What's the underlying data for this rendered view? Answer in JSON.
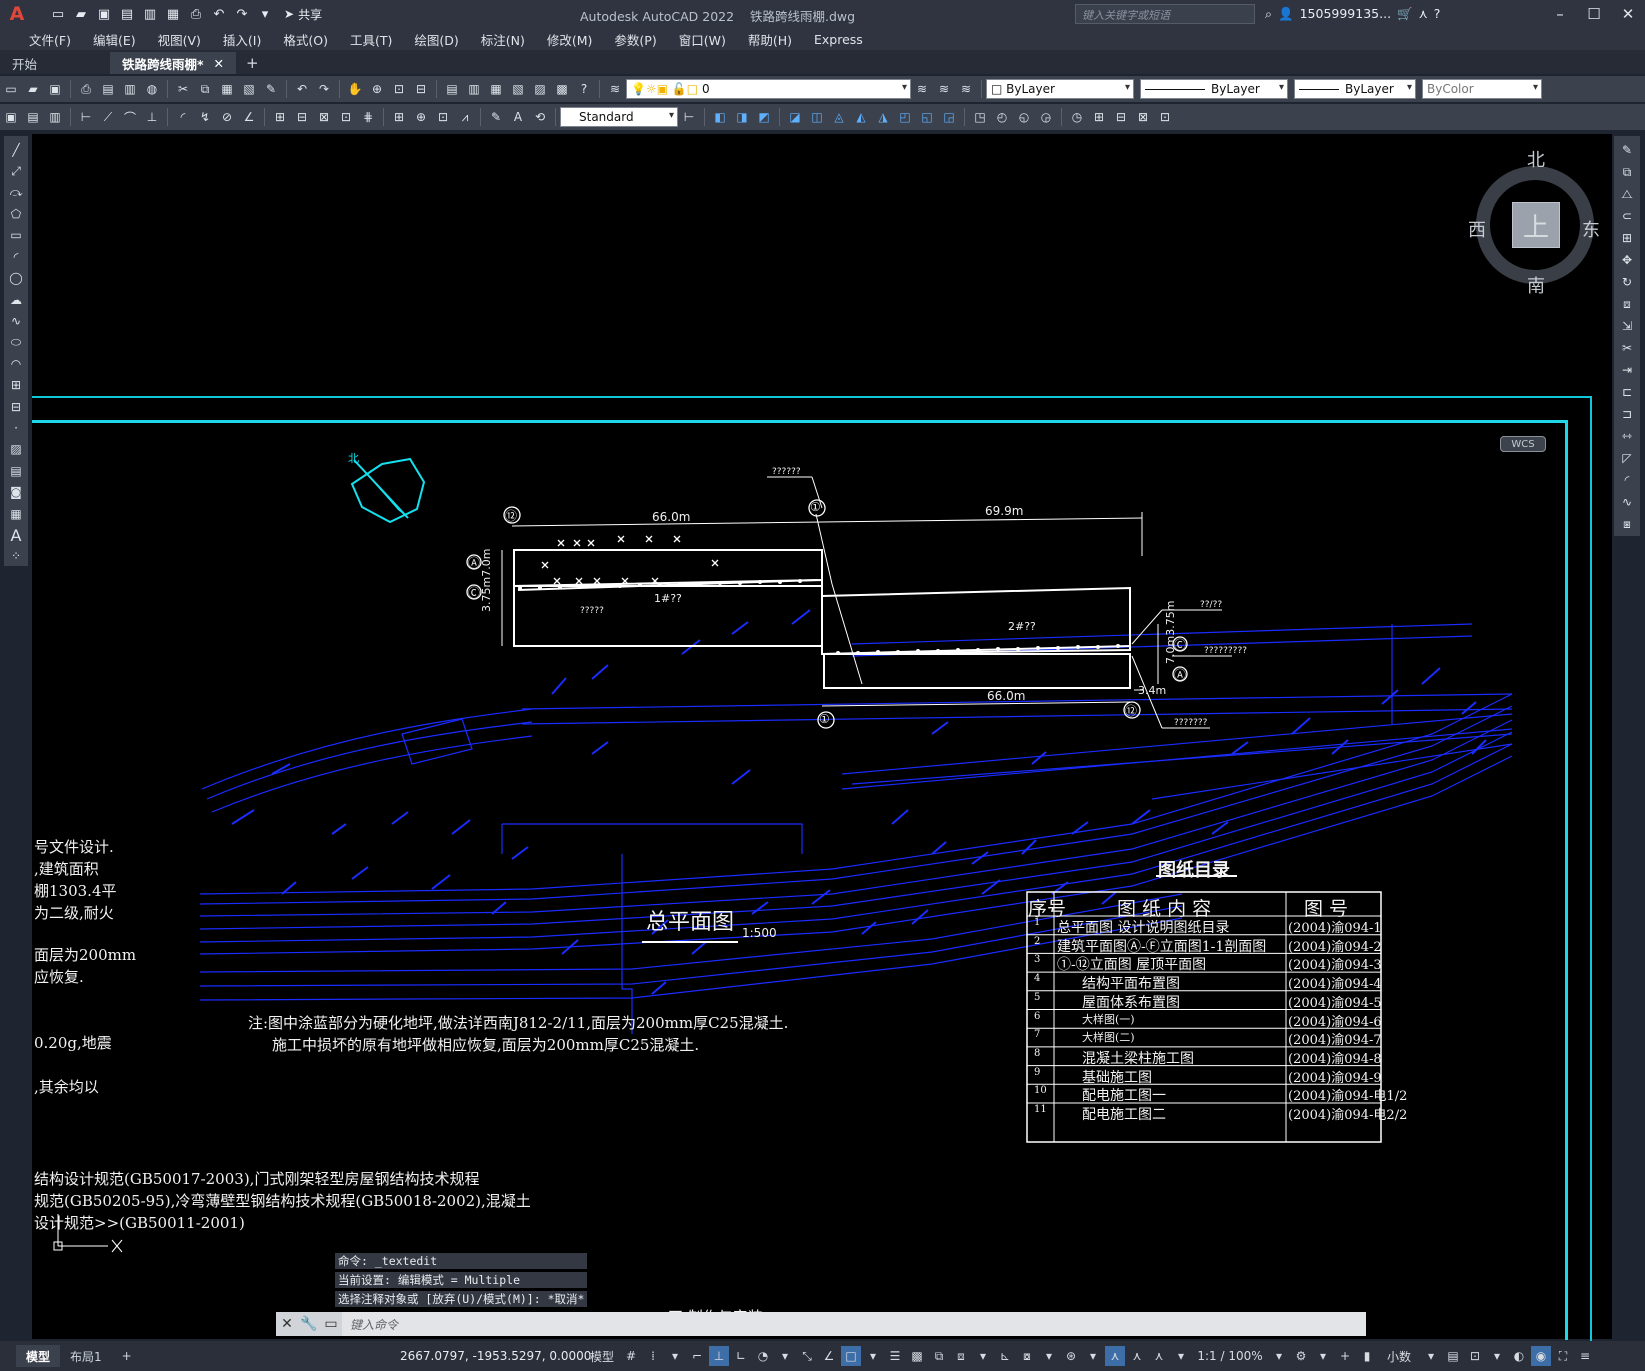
{
  "app": {
    "title": "Autodesk AutoCAD 2022",
    "file": "铁路跨线雨棚.dwg",
    "share_label": "共享",
    "search_placeholder": "键入关键字或短语",
    "user": "1505999135...",
    "logo": "A"
  },
  "menu": [
    "文件(F)",
    "编辑(E)",
    "视图(V)",
    "插入(I)",
    "格式(O)",
    "工具(T)",
    "绘图(D)",
    "标注(N)",
    "修改(M)",
    "参数(P)",
    "窗口(W)",
    "帮助(H)",
    "Express"
  ],
  "tabs": {
    "start": "开始",
    "doc": "铁路跨线雨棚*",
    "close": "✕",
    "add": "+"
  },
  "toolbar": {
    "layer": "0",
    "color": "ByLayer",
    "linetype": "ByLayer",
    "lineweight": "ByLayer",
    "plotstyle": "ByColor",
    "textstyle": "Standard"
  },
  "viewcube": {
    "north": "北",
    "south": "南",
    "east": "东",
    "west": "西",
    "face": "上",
    "wcs": "WCS"
  },
  "drawing": {
    "plan_title": "总平面图",
    "plan_scale": "1:500",
    "dim_top_left": "66.0m",
    "dim_top_right": "69.9m",
    "dim_bottom": "66.0m",
    "dim_left_v": "3.75m7.0m",
    "dim_right_v": "7.0m3.75m",
    "dim_right_small": "3.4m",
    "label_1": "1#??",
    "label_2": "2#??",
    "axis_12a": "⑫",
    "axis_1a": "①",
    "axis_A1": "Ⓐ",
    "axis_C1": "Ⓒ",
    "axis_C2": "Ⓒ",
    "axis_A2": "Ⓐ",
    "axis_1b": "①",
    "axis_12b": "⑫",
    "callout_1": "??????",
    "callout_2": "?????",
    "callout_3": "??/??",
    "callout_4": "?????????",
    "callout_5": "???????",
    "north_arrow": "北",
    "note_1": "注:图中涂蓝部分为硬化地坪,做法详西南J812-2/11,面层为200mm厚C25混凝土.",
    "note_2": "施工中损坏的原有地坪做相应恢复,面层为200mm厚C25混凝土.",
    "left_lines": [
      "号文件设计.",
      ",建筑面积",
      "棚1303.4平",
      "为二级,耐火",
      "面层为200mm",
      "应恢复.",
      "0.20g,地震",
      ",其余均以"
    ],
    "bottom_lines": [
      "结构设计规范(GB50017-2003),门式刚架轻型房屋钢结构技术规程",
      "规范(GB50205-95),冷弯薄壁型钢结构技术规程(GB50018-2002),混凝土",
      "设计规范>>(GB50011-2001)"
    ],
    "bottom_partial": "四.制作与安装"
  },
  "catalog": {
    "title": "图纸目录",
    "headers": [
      "序号",
      "图 纸 内 容",
      "图  号"
    ],
    "rows": [
      [
        "1",
        "总平面图 设计说明图纸目录",
        "(2004)渝094-1"
      ],
      [
        "2",
        "建筑平面图Ⓐ-Ⓕ立面图1-1剖面图",
        "(2004)渝094-2"
      ],
      [
        "3",
        "①-⑫立面图 屋顶平面图",
        "(2004)渝094-3"
      ],
      [
        "4",
        "结构平面布置图",
        "(2004)渝094-4"
      ],
      [
        "5",
        "屋面体系布置图",
        "(2004)渝094-5"
      ],
      [
        "6",
        "大样图(一)",
        "(2004)渝094-6"
      ],
      [
        "7",
        "大样图(二)",
        "(2004)渝094-7"
      ],
      [
        "8",
        "混凝土梁柱施工图",
        "(2004)渝094-8"
      ],
      [
        "9",
        "基础施工图",
        "(2004)渝094-9"
      ],
      [
        "10",
        "配电施工图一",
        "(2004)渝094-电1/2"
      ],
      [
        "11",
        "配电施工图二",
        "(2004)渝094-电2/2"
      ]
    ]
  },
  "command": {
    "history": [
      "命令: _textedit",
      "当前设置: 编辑模式 = Multiple",
      "选择注释对象或 [放弃(U)/模式(M)]: *取消*"
    ],
    "placeholder": "键入命令"
  },
  "status": {
    "model_tab": "模型",
    "layout_tab": "布局1",
    "add": "+",
    "coords": "2667.0797, -1953.5297, 0.0000",
    "model": "模型",
    "scale": "1:1 / 100%",
    "units": "小数"
  }
}
